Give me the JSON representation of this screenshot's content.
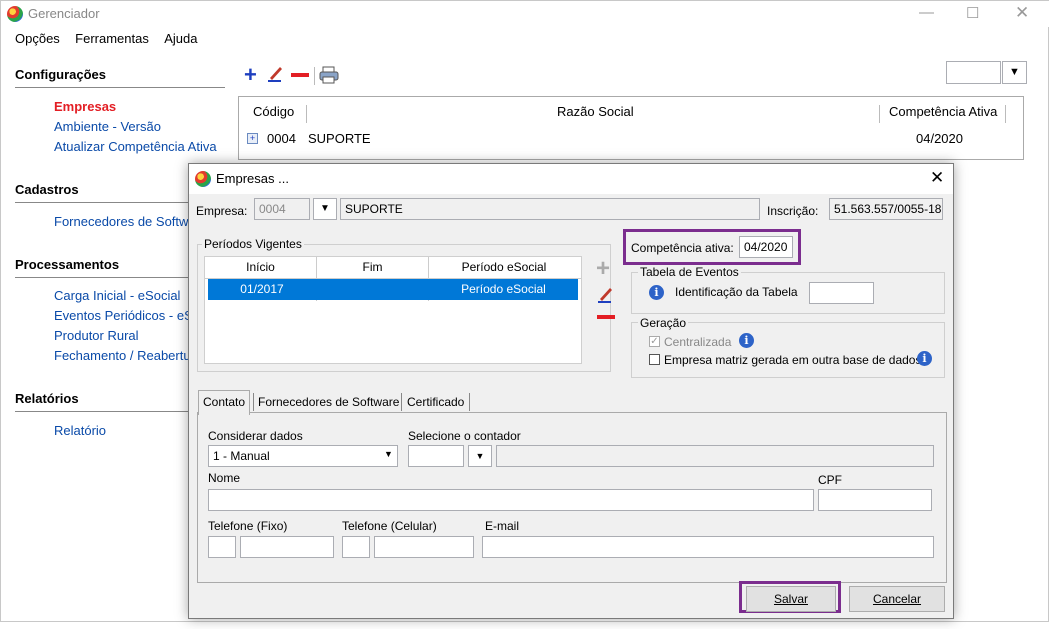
{
  "window": {
    "title": "Gerenciador"
  },
  "menu": [
    "Opções",
    "Ferramentas",
    "Ajuda"
  ],
  "sidebar": {
    "sections": [
      {
        "title": "Configurações",
        "items": [
          "Empresas",
          "Ambiente - Versão",
          "Atualizar Competência Ativa"
        ]
      },
      {
        "title": "Cadastros",
        "items": [
          "Fornecedores de Software"
        ]
      },
      {
        "title": "Processamentos",
        "items": [
          "Carga Inicial - eSocial",
          "Eventos Periódicos - eSocial",
          "Produtor Rural",
          "Fechamento / Reabertura"
        ]
      },
      {
        "title": "Relatórios",
        "items": [
          "Relatório"
        ]
      }
    ],
    "active_item": "Empresas"
  },
  "main_grid": {
    "headers": [
      "Código",
      "Razão Social",
      "Competência Ativa"
    ],
    "rows": [
      {
        "codigo": "0004",
        "razao": "SUPORTE",
        "competencia": "04/2020"
      }
    ]
  },
  "dialog": {
    "title": "Empresas ...",
    "empresa_label": "Empresa:",
    "empresa_code": "0004",
    "empresa_name": "SUPORTE",
    "inscricao_label": "Inscrição:",
    "inscricao_value": "51.563.557/0055-18",
    "periodos_title": "Períodos Vigentes",
    "periodos_headers": [
      "Início",
      "Fim",
      "Período eSocial"
    ],
    "periodos_rows": [
      {
        "inicio": "01/2017",
        "fim": "",
        "periodo": "Período eSocial"
      }
    ],
    "competencia_label": "Competência ativa:",
    "competencia_value": "04/2020",
    "tabela_eventos_title": "Tabela de Eventos",
    "identificacao_label": "Identificação da Tabela",
    "identificacao_value": "",
    "geracao_title": "Geração",
    "centralizada_label": "Centralizada",
    "matriz_label": "Empresa matriz gerada em outra base de dados",
    "tabs": [
      "Contato",
      "Fornecedores de Software",
      "Certificado"
    ],
    "contato": {
      "considerar_label": "Considerar dados",
      "considerar_value": "1 - Manual",
      "contador_label": "Selecione o contador",
      "nome_label": "Nome",
      "cpf_label": "CPF",
      "tel_fixo_label": "Telefone (Fixo)",
      "tel_cel_label": "Telefone (Celular)",
      "email_label": "E-mail"
    },
    "save_label": "Salvar",
    "cancel_label": "Cancelar"
  },
  "colors": {
    "highlight": "#7b2d8e",
    "selection": "#0078d7",
    "link": "#0a4aa8",
    "active": "#e31e24"
  }
}
